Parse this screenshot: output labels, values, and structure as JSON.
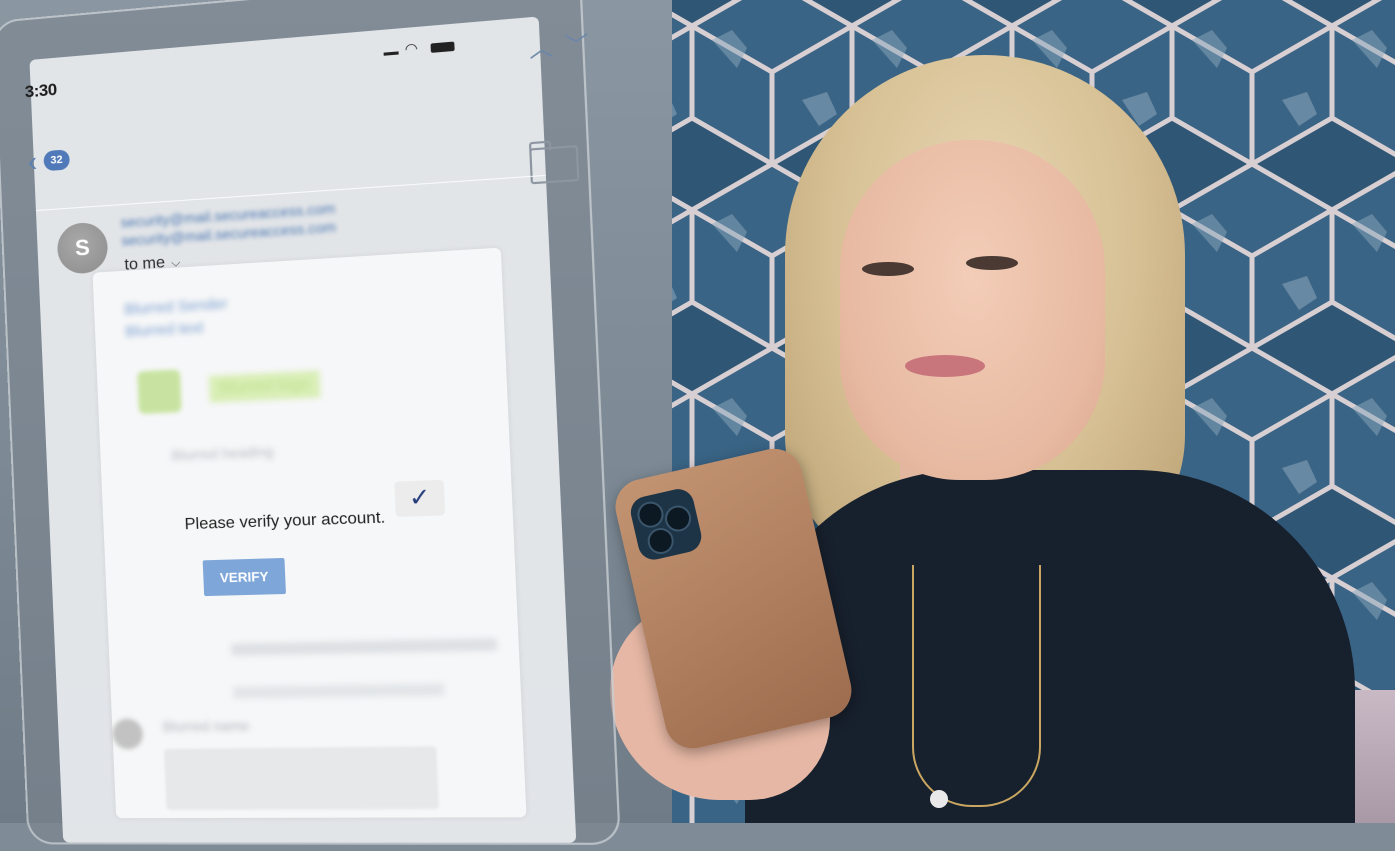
{
  "scene": {
    "colors": {
      "wall": "#808c97",
      "wallpaper": "#2f5674",
      "shirt": "#17202d",
      "phone": "#b0805f"
    }
  },
  "email": {
    "status_bar": {
      "time": "3:30",
      "icons": [
        "signal-icon",
        "wifi-icon",
        "battery-icon"
      ]
    },
    "nav": {
      "up_icon": "chevron-up-icon",
      "down_icon": "chevron-down-icon"
    },
    "back": {
      "icon": "chevron-left-icon",
      "unread_count": "32"
    },
    "folder_icon": "folder-icon",
    "sender": {
      "avatar_letter": "S",
      "email_line_1": "security@mail.secureaccess.com",
      "email_line_2": "security@mail.secureaccess.com",
      "recipient": "to me",
      "recipient_expand_icon": "chevron-down-icon"
    },
    "body": {
      "blurred_line_1": "Blurred Sender",
      "blurred_line_2": "Blurred text",
      "blurred_logo_text": "Blurred logo",
      "blurred_heading": "Blurred heading",
      "verify_prompt": "Please verify your account.",
      "check_icon": "check-icon",
      "verify_button": "VERIFY",
      "footer_name": "Blurred name"
    },
    "colors": {
      "accent": "#4f79b8",
      "button": "#7ea6d9",
      "link": "#4d77b0"
    }
  }
}
